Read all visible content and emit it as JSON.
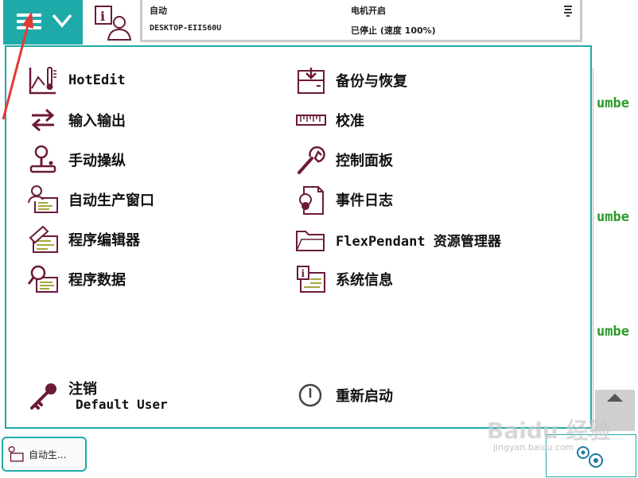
{
  "header": {
    "mode_title": "自动",
    "controller_name": "DESKTOP-EIIS60U",
    "motor_status": "电机开启",
    "run_status": "已停止 (速度 100%)"
  },
  "menu": {
    "left": [
      {
        "label": "HotEdit",
        "icon": "hotedit-icon"
      },
      {
        "label": "输入输出",
        "icon": "inputs-outputs-icon"
      },
      {
        "label": "手动操纵",
        "icon": "jogging-icon"
      },
      {
        "label": "自动生产窗口",
        "icon": "production-window-icon"
      },
      {
        "label": "程序编辑器",
        "icon": "program-editor-icon"
      },
      {
        "label": "程序数据",
        "icon": "program-data-icon"
      }
    ],
    "right": [
      {
        "label": "备份与恢复",
        "icon": "backup-restore-icon"
      },
      {
        "label": "校准",
        "icon": "calibration-icon"
      },
      {
        "label": "控制面板",
        "icon": "control-panel-icon"
      },
      {
        "label": "事件日志",
        "icon": "event-log-icon"
      },
      {
        "label": "FlexPendant 资源管理器",
        "icon": "explorer-folder-icon"
      },
      {
        "label": "系统信息",
        "icon": "system-info-icon"
      }
    ],
    "logoff_label": "注销",
    "user_name": "Default User",
    "restart_label": "重新启动"
  },
  "background": {
    "code_snippets": [
      "umbe",
      "umbe",
      "umbe"
    ]
  },
  "taskbar": {
    "item_label": "自动生..."
  },
  "watermark": {
    "brand": "Baidu 经验",
    "url": "jingyan.baidu.com"
  },
  "colors": {
    "accent": "#1faaaa",
    "icon": "#6b1a3a",
    "code_green": "#2a9a2a",
    "annotation_arrow": "#e53935"
  }
}
